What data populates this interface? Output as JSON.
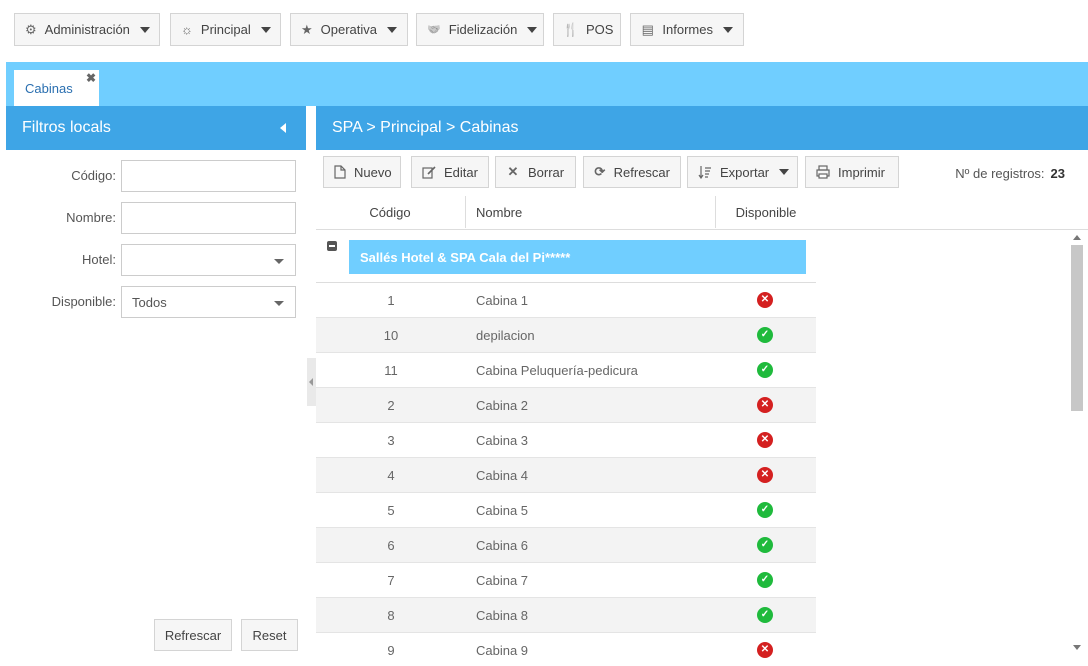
{
  "menu": [
    {
      "label": "Administración",
      "icon": "gear-icon",
      "glyph": "⚙",
      "dropdown": true
    },
    {
      "label": "Principal",
      "icon": "sun-icon",
      "glyph": "☼",
      "dropdown": true
    },
    {
      "label": "Operativa",
      "icon": "star-icon",
      "glyph": "★",
      "dropdown": true
    },
    {
      "label": "Fidelización",
      "icon": "handshake-icon",
      "glyph": "🤝",
      "dropdown": true
    },
    {
      "label": "POS",
      "icon": "cutlery-icon",
      "glyph": "🍴",
      "dropdown": false
    },
    {
      "label": "Informes",
      "icon": "archive-icon",
      "glyph": "▤",
      "dropdown": true
    }
  ],
  "tabs": {
    "active": "Cabinas",
    "close": "✖"
  },
  "filters": {
    "title": "Filtros locals",
    "codigo_label": "Código:",
    "codigo_value": "",
    "nombre_label": "Nombre:",
    "nombre_value": "",
    "hotel_label": "Hotel:",
    "hotel_value": "",
    "disponible_label": "Disponible:",
    "disponible_value": "Todos",
    "refresh_label": "Refrescar",
    "reset_label": "Reset"
  },
  "main": {
    "breadcrumb": "SPA > Principal > Cabinas",
    "toolbar": {
      "nuevo": "Nuevo",
      "editar": "Editar",
      "borrar": "Borrar",
      "refrescar": "Refrescar",
      "exportar": "Exportar",
      "imprimir": "Imprimir"
    },
    "records_label": "Nº de registros:",
    "records_count": "23"
  },
  "grid": {
    "columns": [
      "Código",
      "Nombre",
      "Disponible"
    ],
    "group": "Sallés Hotel & SPA Cala del Pi*****",
    "rows": [
      {
        "code": "1",
        "name": "Cabina 1",
        "available": false
      },
      {
        "code": "10",
        "name": "depilacion",
        "available": true
      },
      {
        "code": "11",
        "name": "Cabina Peluquería-pedicura",
        "available": true
      },
      {
        "code": "2",
        "name": "Cabina 2",
        "available": false
      },
      {
        "code": "3",
        "name": "Cabina 3",
        "available": false
      },
      {
        "code": "4",
        "name": "Cabina 4",
        "available": false
      },
      {
        "code": "5",
        "name": "Cabina 5",
        "available": true
      },
      {
        "code": "6",
        "name": "Cabina 6",
        "available": true
      },
      {
        "code": "7",
        "name": "Cabina 7",
        "available": true
      },
      {
        "code": "8",
        "name": "Cabina 8",
        "available": true
      },
      {
        "code": "9",
        "name": "Cabina 9",
        "available": false
      }
    ]
  },
  "colors": {
    "accent": "#3ea5e6",
    "tabbar": "#70ceff",
    "ok": "#1fba3c",
    "error": "#d42020"
  }
}
